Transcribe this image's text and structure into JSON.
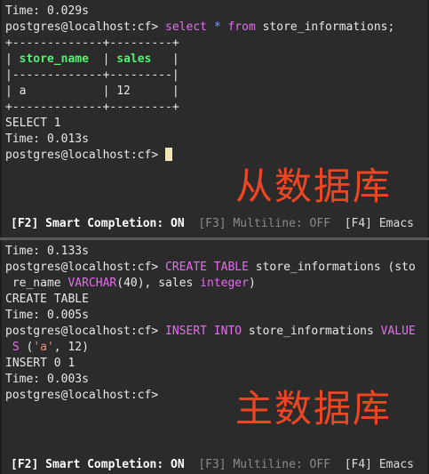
{
  "top_pane": {
    "line_time_prev": "Time: 0.029s",
    "prompt": "postgres@localhost:cf>",
    "query_kw_select": "select",
    "query_star": "*",
    "query_kw_from": "from",
    "query_table": "store_informations;",
    "table_border_top": "+-------------+---------+",
    "table_header_col1": "store_name",
    "table_header_col2": "sales",
    "table_border_mid": "|-------------+---------|",
    "table_row_col1": "a",
    "table_row_col2": "12",
    "table_border_bot": "+-------------+---------+",
    "result_select": "SELECT 1",
    "result_time": "Time: 0.013s",
    "prompt_final": "postgres@localhost:cf>",
    "overlay_label": "从数据库"
  },
  "bottom_pane": {
    "time1": "Time: 0.133s",
    "prompt1": "postgres@localhost:cf>",
    "create_kw": "CREATE TABLE",
    "create_rest": " store_informations (sto",
    "create_cont": " re_name ",
    "create_type1": "VARCHAR",
    "create_mid": "(40), sales ",
    "create_type2": "integer",
    "create_end": ")",
    "create_result": "CREATE TABLE",
    "time2": "Time: 0.005s",
    "prompt2": "postgres@localhost:cf>",
    "insert_kw": "INSERT INTO",
    "insert_rest": " store_informations ",
    "insert_values_kw": "VALUE",
    "insert_cont_kw": " S",
    "insert_open": " (",
    "insert_str": "'a'",
    "insert_mid": ", 12)",
    "insert_result": "INSERT 0 1",
    "time3": "Time: 0.003s",
    "prompt3": "postgres@localhost:cf>",
    "overlay_label": "主数据库"
  },
  "toolbar": {
    "f2": "[F2] Smart Completion: ON",
    "f3": "[F3] Multiline: OFF",
    "f4": "[F4] Emacs"
  },
  "colors": {
    "keyword": "#e66cf0",
    "string": "#e8907a",
    "header": "#4ff26e",
    "overlay": "#ee4622",
    "background": "#2b2b2b"
  }
}
